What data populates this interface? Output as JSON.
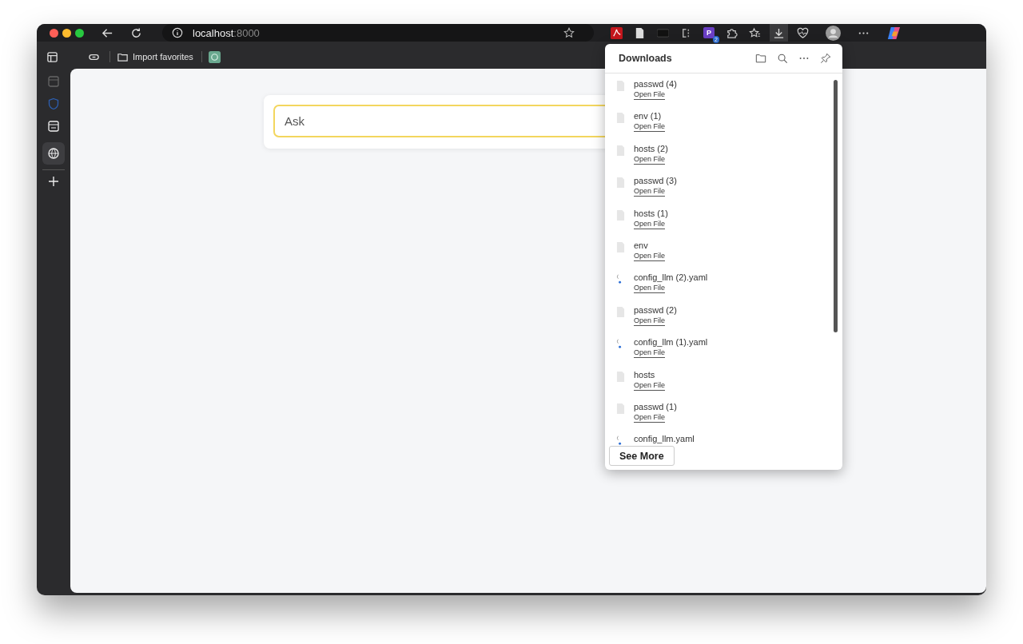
{
  "address_bar": {
    "host": "localhost",
    "port": ":8000"
  },
  "favorites_bar": {
    "import_label": "Import favorites"
  },
  "extensions": [
    {
      "kind": "pdf"
    },
    {
      "kind": "doc"
    },
    {
      "kind": "dark"
    },
    {
      "kind": "ci"
    },
    {
      "kind": "letter",
      "letter": "P",
      "badge": "2"
    },
    {
      "kind": "puzzle"
    }
  ],
  "ask_field": {
    "placeholder": "Ask"
  },
  "downloads": {
    "title": "Downloads",
    "items": [
      {
        "name": "passwd (4)",
        "kind": "file",
        "action": "Open File"
      },
      {
        "name": "env (1)",
        "kind": "file",
        "action": "Open File"
      },
      {
        "name": "hosts (2)",
        "kind": "file",
        "action": "Open File"
      },
      {
        "name": "passwd (3)",
        "kind": "file",
        "action": "Open File"
      },
      {
        "name": "hosts (1)",
        "kind": "file",
        "action": "Open File"
      },
      {
        "name": "env",
        "kind": "file",
        "action": "Open File"
      },
      {
        "name": "config_llm (2).yaml",
        "kind": "yaml",
        "action": "Open File"
      },
      {
        "name": "passwd (2)",
        "kind": "file",
        "action": "Open File"
      },
      {
        "name": "config_llm (1).yaml",
        "kind": "yaml",
        "action": "Open File"
      },
      {
        "name": "hosts",
        "kind": "file",
        "action": "Open File"
      },
      {
        "name": "passwd (1)",
        "kind": "file",
        "action": "Open File"
      },
      {
        "name": "config_llm.yaml",
        "kind": "yaml"
      }
    ],
    "see_more": "See More"
  }
}
